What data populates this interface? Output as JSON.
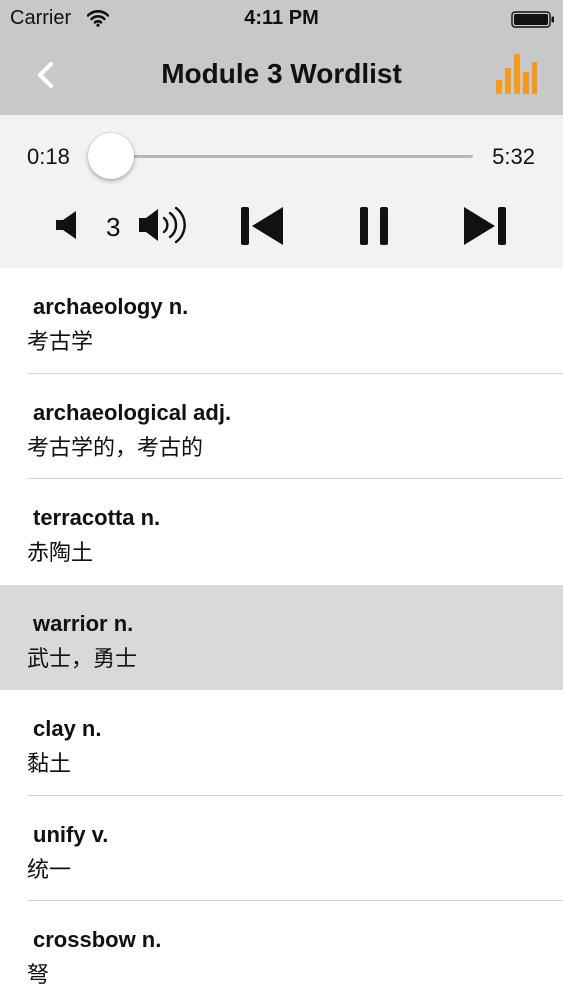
{
  "status_bar": {
    "carrier": "Carrier",
    "time": "4:11 PM"
  },
  "nav": {
    "title": "Module 3 Wordlist",
    "back_icon": "chevron-left-icon",
    "chart_icon": "bar-chart-icon",
    "accent_color": "#f59a1c"
  },
  "player": {
    "current_time": "0:18",
    "total_time": "5:32",
    "progress": 0.054,
    "volume_level": "3",
    "icons": [
      "volume-down-icon",
      "volume-up-icon",
      "skip-previous-icon",
      "pause-icon",
      "skip-next-icon"
    ],
    "progress_color": "#1e9ad6"
  },
  "words": [
    {
      "term": "archaeology n.",
      "meaning": "考古学",
      "selected": false
    },
    {
      "term": "archaeological adj.",
      "meaning": "考古学的，考古的",
      "selected": false
    },
    {
      "term": "terracotta n.",
      "meaning": "赤陶土",
      "selected": false
    },
    {
      "term": "warrior n.",
      "meaning": "武士，勇士",
      "selected": true
    },
    {
      "term": "clay n.",
      "meaning": "黏土",
      "selected": false
    },
    {
      "term": "unify v.",
      "meaning": "统一",
      "selected": false
    },
    {
      "term": "crossbow n.",
      "meaning": "弩",
      "selected": false
    }
  ]
}
